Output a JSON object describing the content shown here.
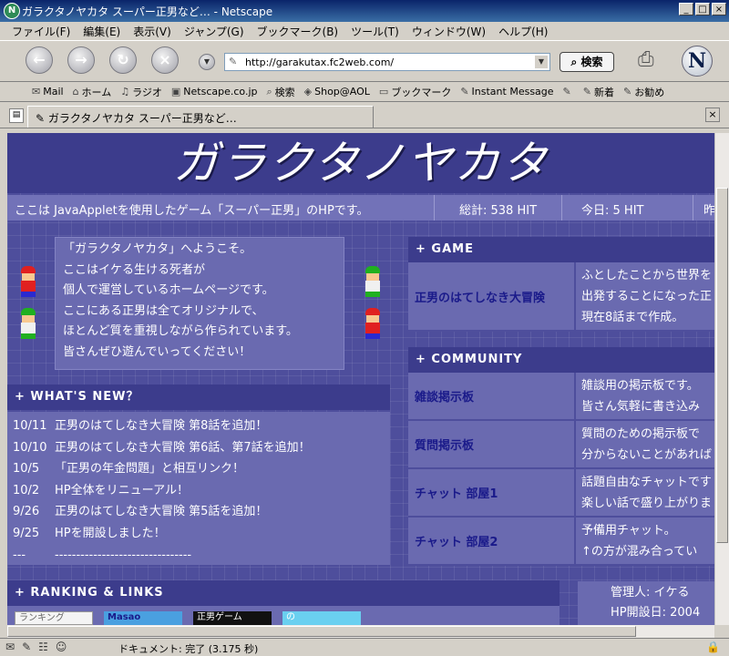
{
  "window": {
    "title": "ガラクタノヤカタ スーパー正男など… - Netscape",
    "minimize": "_",
    "maximize": "□",
    "close": "×"
  },
  "menu": [
    "ファイル(F)",
    "編集(E)",
    "表示(V)",
    "ジャンプ(G)",
    "ブックマーク(B)",
    "ツール(T)",
    "ウィンドウ(W)",
    "ヘルプ(H)"
  ],
  "nav": {
    "url": "http://garakutax.fc2web.com/",
    "search_label": "検索",
    "logo": "N"
  },
  "bookmarks": [
    {
      "icon": "✉",
      "label": "Mail"
    },
    {
      "icon": "⌂",
      "label": "ホーム"
    },
    {
      "icon": "♫",
      "label": "ラジオ"
    },
    {
      "icon": "▣",
      "label": "Netscape.co.jp"
    },
    {
      "icon": "⌕",
      "label": "検索"
    },
    {
      "icon": "◈",
      "label": "Shop@AOL"
    },
    {
      "icon": "▭",
      "label": "ブックマーク"
    },
    {
      "icon": "✎",
      "label": "Instant Message"
    },
    {
      "icon": "✎",
      "label": ""
    },
    {
      "icon": "✎",
      "label": "新着"
    },
    {
      "icon": "✎",
      "label": "お勧め"
    }
  ],
  "tab": {
    "label": "ガラクタノヤカタ スーパー正男など…"
  },
  "status": {
    "message": "ドキュメント: 完了 (3.175 秒)"
  },
  "site": {
    "title": "ガラクタノヤカタ",
    "description": "ここは JavaAppletを使用したゲーム「スーパー正男」のHPです。",
    "total_hits": "総計: 538 HIT",
    "today_hits": "今日: 5 HIT",
    "cutoff": "昨",
    "welcome": [
      "「ガラクタノヤカタ」へようこそ。",
      "ここはイケる生ける死者が",
      "個人で運営しているホームページです。",
      "ここにある正男は全てオリジナルで、",
      "ほとんど質を重視しながら作られています。",
      "皆さんぜひ遊んでいってください！"
    ],
    "whats_new_heading": "+ WHAT'S NEW？",
    "news": [
      {
        "date": "10/11",
        "text": "正男のはてしなき大冒険 第8話を追加！"
      },
      {
        "date": "10/10",
        "text": "正男のはてしなき大冒険 第6話、第7話を追加！"
      },
      {
        "date": "10/5",
        "text": "「正男の年金問題」と相互リンク！"
      },
      {
        "date": "10/2",
        "text": "HP全体をリニューアル！"
      },
      {
        "date": "9/26",
        "text": "正男のはてしなき大冒険 第5話を追加！"
      },
      {
        "date": "9/25",
        "text": "HPを開設しました！"
      },
      {
        "date": "---",
        "text": "--------------------------------"
      }
    ],
    "game_heading": "+ GAME",
    "game_rows": [
      {
        "name": "正男のはてしなき大冒険",
        "lines": [
          "ふとしたことから世界を",
          "出発することになった正",
          "現在8話まで作成。"
        ]
      }
    ],
    "community_heading": "+ COMMUNITY",
    "community_rows": [
      {
        "name": "雑談掲示板",
        "lines": [
          "雑談用の掲示板です。",
          "皆さん気軽に書き込み"
        ]
      },
      {
        "name": "質問掲示板",
        "lines": [
          "質問のための掲示板で",
          "分からないことがあれば"
        ]
      },
      {
        "name": "チャット 部屋1",
        "lines": [
          "話題自由なチャットです",
          "楽しい話で盛り上がりま"
        ]
      },
      {
        "name": "チャット 部屋2",
        "lines": [
          "予備用チャット。",
          "↑の方が混み合ってい"
        ]
      }
    ],
    "ranking_heading": "+ RANKING & LINKS",
    "link_banners": [
      "ランキング",
      "Masao",
      "正男ゲーム",
      "の"
    ],
    "admin": [
      "管理人: イケる",
      "HP開設日: 2004"
    ]
  }
}
